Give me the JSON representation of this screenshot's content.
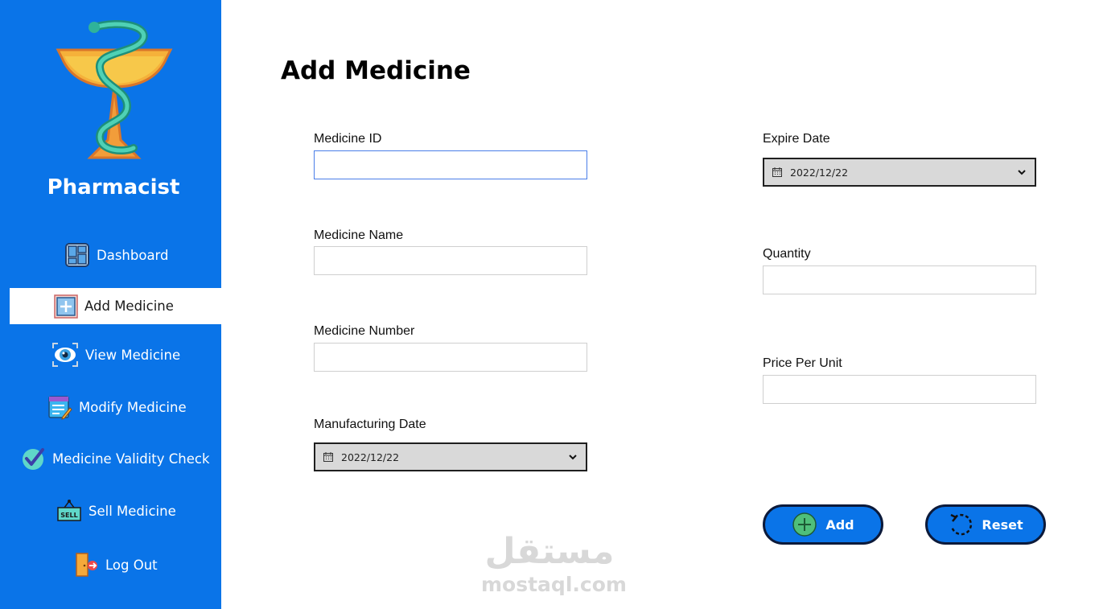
{
  "sidebar": {
    "brand": "Pharmacist",
    "logo_icon": "bowl-of-hygieia-icon",
    "background_color": "#0a74e8",
    "items": [
      {
        "label": "Dashboard",
        "icon": "dashboard-icon"
      },
      {
        "label": "Add Medicine",
        "icon": "add-icon",
        "active": true
      },
      {
        "label": "View Medicine",
        "icon": "eye-icon"
      },
      {
        "label": "Modify Medicine",
        "icon": "edit-list-icon"
      },
      {
        "label": "Medicine Validity Check",
        "icon": "check-icon"
      },
      {
        "label": "Sell Medicine",
        "icon": "sell-sign-icon"
      },
      {
        "label": "Log Out",
        "icon": "logout-door-icon"
      }
    ]
  },
  "main": {
    "title": "Add Medicine",
    "fields": {
      "medicine_id": {
        "label": "Medicine ID",
        "value": ""
      },
      "medicine_name": {
        "label": "Medicine Name",
        "value": ""
      },
      "medicine_number": {
        "label": "Medicine Number",
        "value": ""
      },
      "manufacturing_date": {
        "label": "Manufacturing Date",
        "value": "2022/12/22"
      },
      "expire_date": {
        "label": "Expire Date",
        "value": "2022/12/22"
      },
      "quantity": {
        "label": "Quantity",
        "value": ""
      },
      "price_per_unit": {
        "label": "Price Per Unit",
        "value": ""
      }
    },
    "buttons": {
      "add": {
        "label": "Add",
        "icon": "plus-circle-icon"
      },
      "reset": {
        "label": "Reset",
        "icon": "reset-icon"
      }
    }
  },
  "watermark": {
    "arabic_logo_text": "مستقل",
    "text": "mostaql.com"
  }
}
